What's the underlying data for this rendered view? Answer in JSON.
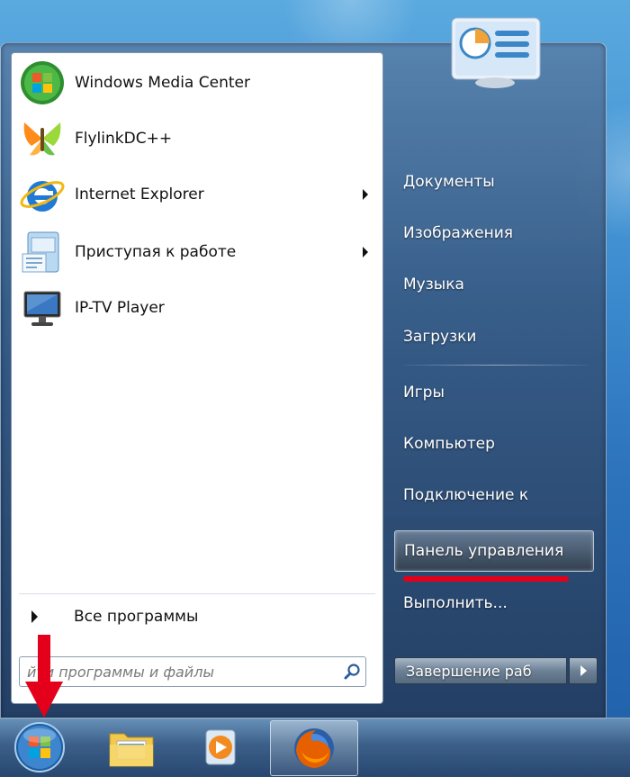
{
  "left_pane": {
    "pinned_programs": [
      {
        "label": "Windows Media Center",
        "icon": "windows-media-center-icon",
        "has_submenu": false
      },
      {
        "label": "FlylinkDC++",
        "icon": "flylinkdc-icon",
        "has_submenu": false
      },
      {
        "label": "Internet Explorer",
        "icon": "internet-explorer-icon",
        "has_submenu": true
      },
      {
        "label": "Приступая к работе",
        "icon": "getting-started-icon",
        "has_submenu": true
      },
      {
        "label": "IP-TV Player",
        "icon": "iptv-player-icon",
        "has_submenu": false
      }
    ],
    "all_programs_label": "Все программы",
    "search": {
      "placeholder": "йти программы и файлы",
      "icon": "search-icon"
    }
  },
  "right_pane": {
    "items": [
      {
        "label": "Документы"
      },
      {
        "label": "Изображения"
      },
      {
        "label": "Музыка"
      },
      {
        "label": "Загрузки"
      },
      {
        "label": "Игры"
      },
      {
        "label": "Компьютер"
      },
      {
        "label": "Подключение к"
      },
      {
        "label": "Панель управления",
        "highlighted": true
      },
      {
        "label": "Выполнить..."
      }
    ],
    "shutdown_label": "Завершение раб"
  },
  "taskbar": {
    "buttons": [
      {
        "name": "start-orb",
        "icon": "windows-start-orb-icon"
      },
      {
        "name": "explorer",
        "icon": "folder-libraries-icon"
      },
      {
        "name": "media-player",
        "icon": "media-player-icon"
      },
      {
        "name": "firefox",
        "icon": "firefox-icon",
        "active": true
      }
    ]
  },
  "annotations": {
    "arrow_color": "#e4001b",
    "underline_color": "#e4001b"
  }
}
